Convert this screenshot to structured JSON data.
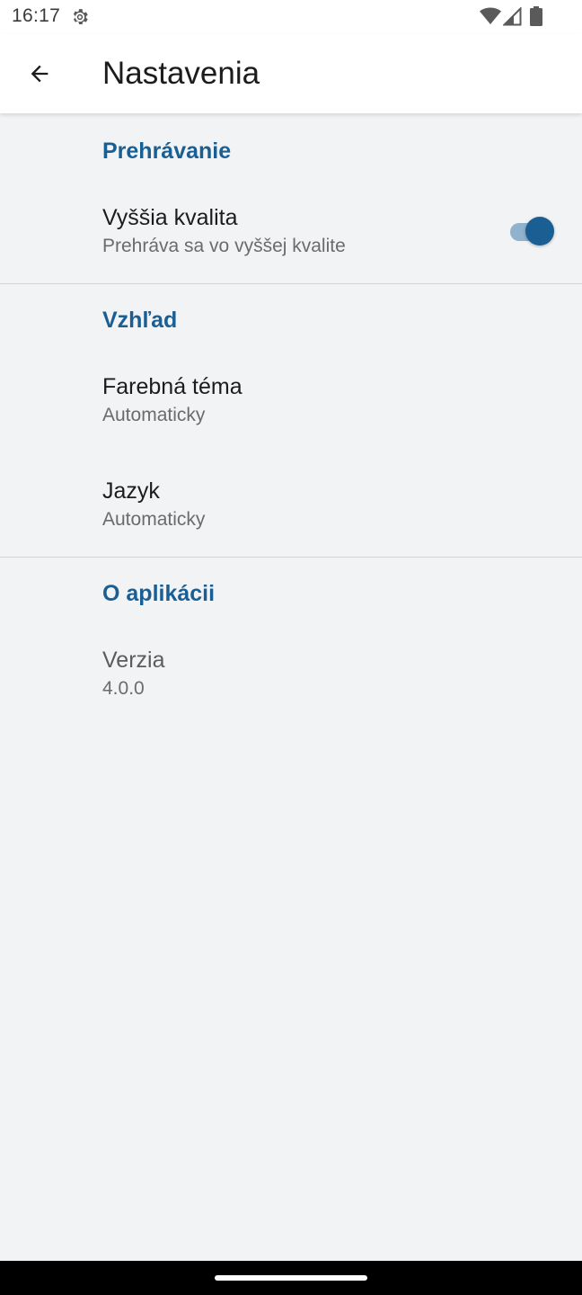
{
  "status_bar": {
    "time": "16:17",
    "icons": [
      "settings-gear-icon",
      "wifi-icon",
      "signal-icon",
      "battery-icon"
    ]
  },
  "app_bar": {
    "back_icon": "arrow-back-icon",
    "title": "Nastavenia"
  },
  "sections": {
    "playback": {
      "header": "Prehrávanie",
      "higher_quality": {
        "title": "Vyššia kvalita",
        "summary": "Prehráva sa vo vyššej kvalite",
        "enabled": true
      }
    },
    "appearance": {
      "header": "Vzhľad",
      "color_theme": {
        "title": "Farebná téma",
        "summary": "Automaticky"
      },
      "language": {
        "title": "Jazyk",
        "summary": "Automaticky"
      }
    },
    "about": {
      "header": "O aplikácii",
      "version": {
        "title": "Verzia",
        "summary": "4.0.0"
      }
    }
  },
  "colors": {
    "accent": "#1a5f94",
    "background": "#f2f3f5",
    "surface": "#ffffff"
  }
}
